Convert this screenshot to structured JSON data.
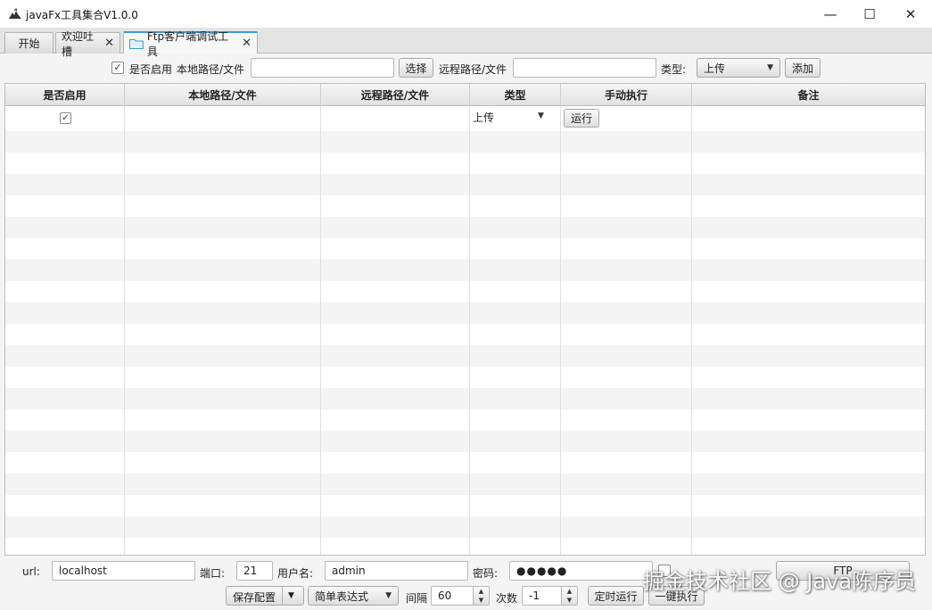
{
  "window": {
    "title": "javaFx工具集合V1.0.0",
    "minimize_glyph": "—",
    "maximize_glyph": "☐",
    "close_glyph": "✕"
  },
  "tabs": [
    {
      "label": "开始",
      "closable": false,
      "active": false
    },
    {
      "label": "欢迎吐槽",
      "closable": true,
      "active": false
    },
    {
      "label": "Ftp客户端调试工具",
      "closable": true,
      "active": true,
      "icon": "folder-icon"
    }
  ],
  "tab_close_glyph": "✕",
  "toolbar": {
    "enabled_checked": true,
    "enabled_label": "是否启用",
    "local_path_label": "本地路径/文件",
    "local_path_value": "",
    "select_button": "选择",
    "remote_path_label": "远程路径/文件",
    "remote_path_value": "",
    "type_label": "类型:",
    "type_value": "上传",
    "add_button": "添加"
  },
  "table": {
    "columns": [
      "是否启用",
      "本地路径/文件",
      "远程路径/文件",
      "类型",
      "手动执行",
      "备注"
    ],
    "rows": [
      {
        "enabled": true,
        "local": "",
        "remote": "",
        "type": "上传",
        "action": "运行",
        "note": ""
      }
    ],
    "empty_rows": 20
  },
  "bottom": {
    "url_label": "url:",
    "url_value": "localhost",
    "port_label": "端口:",
    "port_value": "21",
    "user_label": "用户名:",
    "user_value": "admin",
    "password_label": "密码:",
    "password_value": "●●●●●",
    "save_config": "保存配置",
    "expression_mode": "简单表达式",
    "interval_label": "间隔",
    "interval_value": "60",
    "count_label": "次数",
    "count_value": "-1",
    "timed_run": "定时运行",
    "run_all": "一键执行",
    "ftp_button": "FTP"
  },
  "watermark": "掘金技术社区 @ Java陈序员",
  "colors": {
    "active_tab_accent": "#3c9bd6",
    "window_bg": "#f4f4f4"
  }
}
